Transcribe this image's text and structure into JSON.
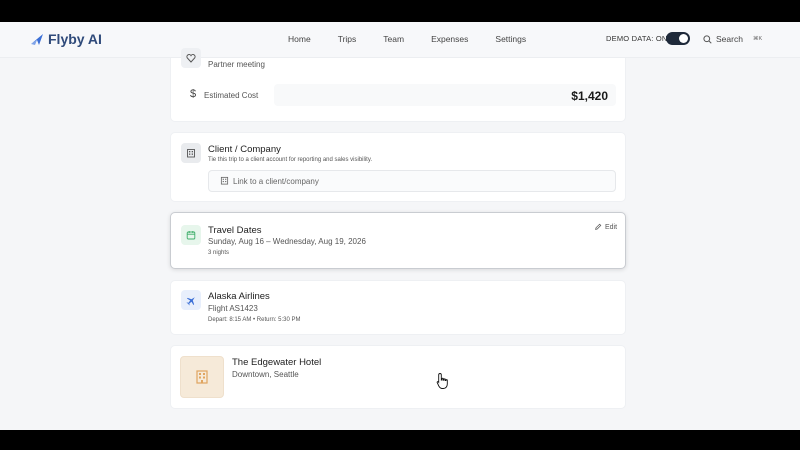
{
  "app": {
    "name": "Flyby AI"
  },
  "nav": {
    "items": [
      "Home",
      "Trips",
      "Team",
      "Expenses",
      "Settings"
    ]
  },
  "header": {
    "demo_label": "DEMO DATA: ON",
    "demo_on": true,
    "search_label": "Search",
    "search_shortcut": "⌘K"
  },
  "purpose": {
    "value": "Partner meeting"
  },
  "cost": {
    "label": "Estimated Cost",
    "value": "$1,420"
  },
  "client": {
    "title": "Client / Company",
    "description": "Tie this trip to a client account for reporting and sales visibility.",
    "placeholder": "Link to a client/company"
  },
  "dates": {
    "title": "Travel Dates",
    "range": "Sunday, Aug 16 – Wednesday, Aug 19, 2026",
    "nights": "3 nights",
    "edit_label": "Edit"
  },
  "flight": {
    "airline": "Alaska Airlines",
    "number": "Flight AS1423",
    "times": "Depart: 8:15 AM • Return: 5:30 PM"
  },
  "hotel": {
    "name": "The Edgewater Hotel",
    "location": "Downtown, Seattle"
  },
  "colors": {
    "accent_blue": "#3b6fd6",
    "green": "#3fae6a",
    "hotel_orange": "#e0a560",
    "toggle": "#1f2a3a"
  }
}
